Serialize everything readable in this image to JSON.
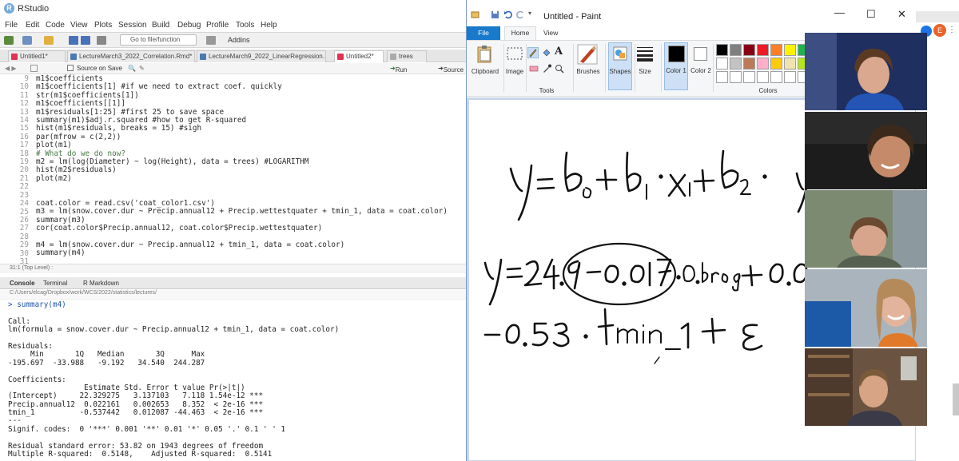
{
  "rstudio": {
    "window_title": "RStudio",
    "menu": [
      "File",
      "Edit",
      "Code",
      "View",
      "Plots",
      "Session",
      "Build",
      "Debug",
      "Profile",
      "Tools",
      "Help"
    ],
    "toolbar": {
      "goto_placeholder": "Go to file/function",
      "addins_label": "Addins"
    },
    "tabs": [
      {
        "label": "Untitled1*",
        "active": false
      },
      {
        "label": "LectureMarch3_2022_Correlation.Rmd*",
        "active": false
      },
      {
        "label": "LectureMarch9_2022_LinearRegression...",
        "active": false
      },
      {
        "label": "Untitled2*",
        "active": true
      },
      {
        "label": "trees",
        "active": false
      }
    ],
    "editor_toolbar": {
      "source_on_save": "Source on Save",
      "run": "Run",
      "source": "Source"
    },
    "line_numbers": [
      "9",
      "10",
      "11",
      "12",
      "13",
      "14",
      "15",
      "16",
      "17",
      "18",
      "19",
      "20",
      "21",
      "22",
      "23",
      "24",
      "25",
      "26",
      "27",
      "28",
      "29",
      "30",
      "31"
    ],
    "code_lines": [
      "m1$coefficients",
      "m1$coefficients[1] #if we need to extract coef. quickly",
      "str(m1$coefficients[1])",
      "m1$coefficients[[1]]",
      "m1$residuals[1:25] #first 25 to save space",
      "summary(m1)$adj.r.squared #how to get R-squared",
      "hist(m1$residuals, breaks = 15) #sigh",
      "par(mfrow = c(2,2))",
      "plot(m1)",
      "# What do we do now?",
      "m2 = lm(log(Diameter) ~ log(Height), data = trees) #LOGARITHM",
      "hist(m2$residuals)",
      "plot(m2)",
      "",
      "",
      "coat.color = read.csv('coat_color1.csv')",
      "m3 = lm(snow.cover.dur ~ Precip.annual12 + Precip.wettestquater + tmin_1, data = coat.color)",
      "summary(m3)",
      "cor(coat.color$Precip.annual12, coat.color$Precip.wettestquater)",
      "",
      "m4 = lm(snow.cover.dur ~ Precip.annual12 + tmin_1, data = coat.color)",
      "summary(m4)",
      ""
    ],
    "status_bar": "31:1   (Top Level) :",
    "console_tabs": [
      "Console",
      "Terminal",
      "R Markdown"
    ],
    "console_path": "C:/Users/elcag/Dropbox/work/WCS/2022/statistics/lectures/",
    "console_lines": [
      "> summary(m4)",
      "",
      "Call:",
      "lm(formula = snow.cover.dur ~ Precip.annual12 + tmin_1, data = coat.color)",
      "",
      "Residuals:",
      "     Min       1Q   Median       3Q      Max",
      "-195.697  -33.988   -9.192   34.540  244.287",
      "",
      "Coefficients:",
      "                 Estimate Std. Error t value Pr(>|t|)",
      "(Intercept)     22.329275   3.137103   7.118 1.54e-12 ***",
      "Precip.annual12  0.022161   0.002653   8.352  < 2e-16 ***",
      "tmin_1          -0.537442   0.012087 -44.463  < 2e-16 ***",
      "---",
      "Signif. codes:  0 '***' 0.001 '**' 0.01 '*' 0.05 '.' 0.1 ' ' 1",
      "",
      "Residual standard error: 53.82 on 1943 degrees of freedom",
      "Multiple R-squared:  0.5148,    Adjusted R-squared:  0.5141"
    ]
  },
  "paint": {
    "window_title": "Untitled - Paint",
    "tabs": {
      "file": "File",
      "home": "Home",
      "view": "View"
    },
    "groups": {
      "clipboard": "Clipboard",
      "image": "Image",
      "tools": "Tools",
      "brushes": "Brushes",
      "shapes": "Shapes",
      "size": "Size",
      "color1": "Color 1",
      "color2": "Color 2",
      "colors": "Colors"
    },
    "palette_row1": [
      "#000000",
      "#7f7f7f",
      "#880015",
      "#ed1c24",
      "#ff7f27",
      "#fff200",
      "#22b14c"
    ],
    "palette_row2": [
      "#ffffff",
      "#c3c3c3",
      "#b97a57",
      "#ffaec9",
      "#ffc90e",
      "#efe4b0",
      "#b5e61d"
    ],
    "handwriting": {
      "line1": "y = b₀ + b₁ · x₁ + b₂ ·",
      "line2": "y = 24.9 − 0.017 · 0.brog + 0.0",
      "line3": "− 0.53 · tmin_1 + ε"
    }
  },
  "video": {
    "participant_count": 5,
    "tiles": [
      "participant-1",
      "participant-2",
      "participant-3",
      "participant-4",
      "participant-5"
    ]
  }
}
